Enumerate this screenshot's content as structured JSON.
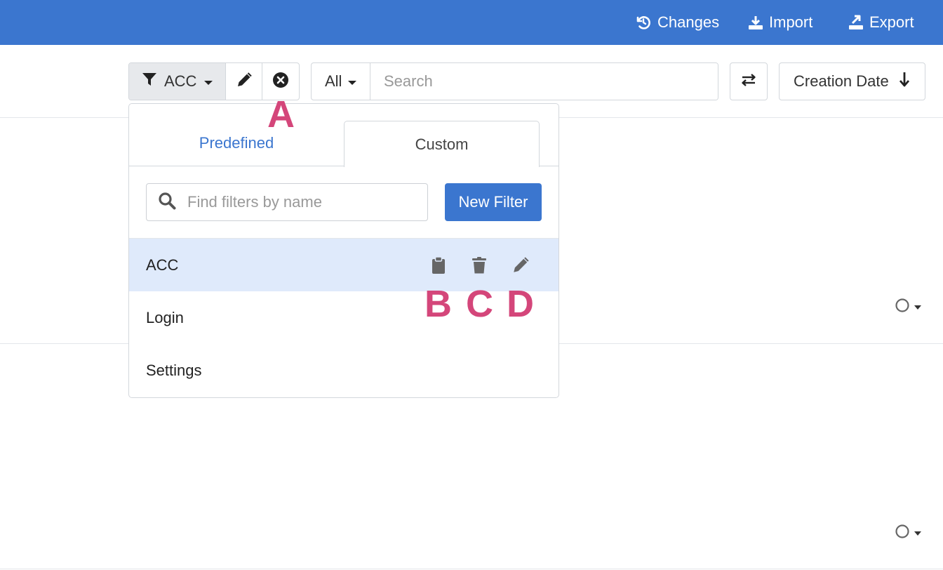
{
  "header": {
    "actions": [
      {
        "label": "Changes",
        "icon": "history-icon"
      },
      {
        "label": "Import",
        "icon": "import-icon"
      },
      {
        "label": "Export",
        "icon": "export-icon"
      }
    ],
    "background": "#3b76cf"
  },
  "toolbar": {
    "filter_label": "ACC",
    "scope_label": "All",
    "search_placeholder": "Search",
    "sort_label": "Creation Date"
  },
  "filter_panel": {
    "tabs": [
      {
        "label": "Predefined",
        "active": false
      },
      {
        "label": "Custom",
        "active": true
      }
    ],
    "find_placeholder": "Find filters by name",
    "new_filter_label": "New Filter",
    "items": [
      {
        "label": "ACC",
        "selected": true,
        "actions": [
          "clipboard-icon",
          "trash-icon",
          "pencil-icon"
        ]
      },
      {
        "label": "Login",
        "selected": false
      },
      {
        "label": "Settings",
        "selected": false
      }
    ]
  },
  "markers": {
    "a": "A",
    "b": "B",
    "c": "C",
    "d": "D"
  },
  "colors": {
    "accent": "#3b76cf",
    "marker": "#d4467a",
    "selected_row": "#dfeafb"
  }
}
